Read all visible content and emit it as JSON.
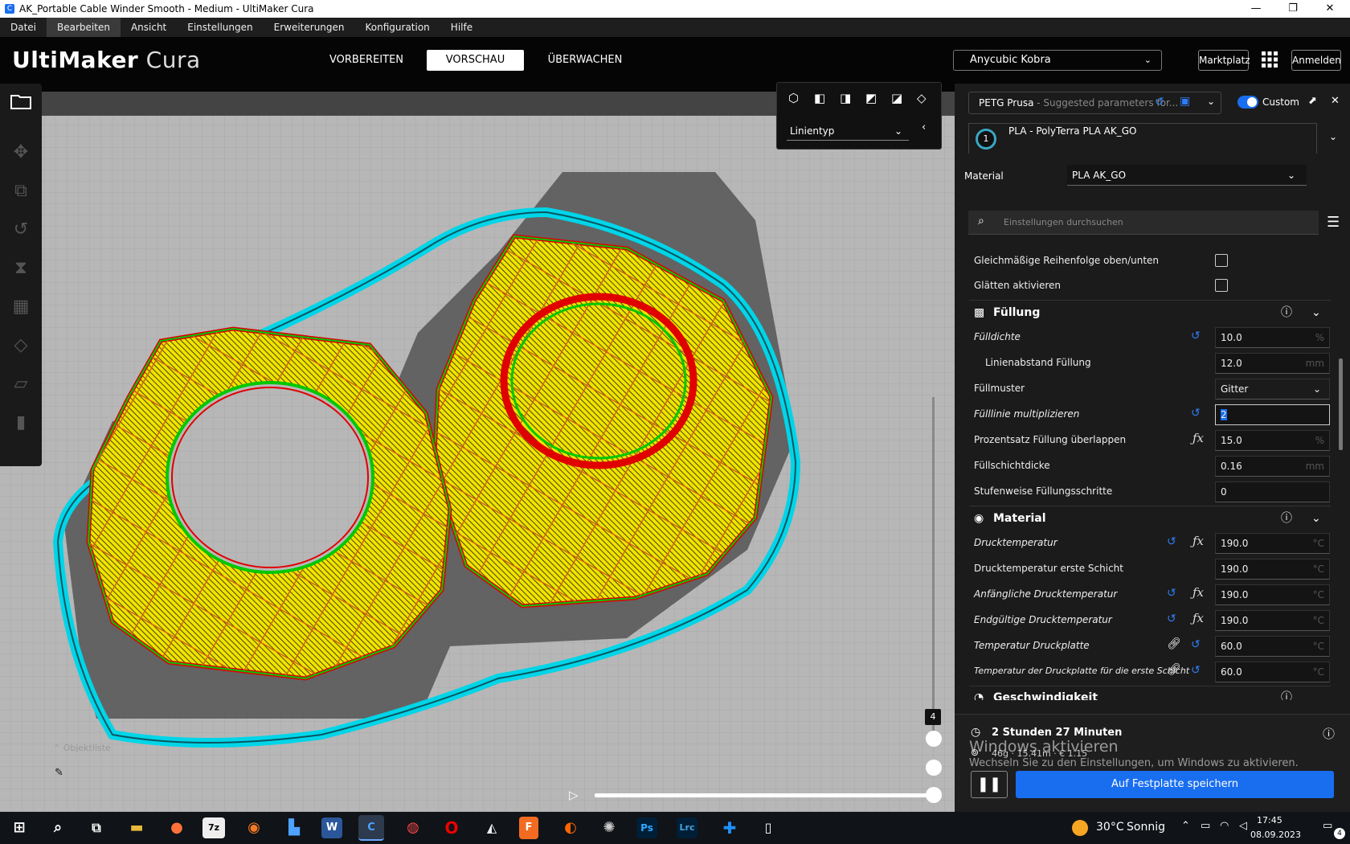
{
  "window": {
    "title": "AK_Portable Cable Winder Smooth - Medium - UltiMaker Cura"
  },
  "menu": [
    "Datei",
    "Bearbeiten",
    "Ansicht",
    "Einstellungen",
    "Erweiterungen",
    "Konfiguration",
    "Hilfe"
  ],
  "header": {
    "logo_bold": "UltiMaker",
    "logo_light": "Cura",
    "stages": [
      "VORBEREITEN",
      "VORSCHAU",
      "ÜBERWACHEN"
    ],
    "printer": "Anycubic Kobra",
    "marketplace": "Marktplatz",
    "signin": "Anmelden"
  },
  "viewport": {
    "view_type": "Linientyp",
    "layer_number": "4",
    "object_list": "Objektliste"
  },
  "profile": {
    "name": "PETG Prusa",
    "suffix": " - Suggested parameters for...",
    "custom_label": "Custom"
  },
  "extruder": {
    "number": "1",
    "material": "PLA - PolyTerra PLA AK_GO"
  },
  "material_row": {
    "label": "Material",
    "value": "PLA AK_GO"
  },
  "search": {
    "placeholder": "Einstellungen durchsuchen"
  },
  "settings_top": [
    {
      "label": "Gleichmäßige Reihenfolge oben/unten"
    },
    {
      "label": "Glätten aktivieren"
    }
  ],
  "sections": {
    "infill": "Füllung",
    "material": "Material",
    "speed": "Geschwindigkeit"
  },
  "infill": [
    {
      "label": "Fülldichte",
      "value": "10.0",
      "unit": "%"
    },
    {
      "label": "Linienabstand Füllung",
      "value": "12.0",
      "unit": "mm"
    },
    {
      "label": "Füllmuster",
      "value": "Gitter"
    },
    {
      "label": "Fülllinie multiplizieren",
      "value": "2"
    },
    {
      "label": "Prozentsatz Füllung überlappen",
      "value": "15.0",
      "unit": "%"
    },
    {
      "label": "Füllschichtdicke",
      "value": "0.16",
      "unit": "mm"
    },
    {
      "label": "Stufenweise Füllungsschritte",
      "value": "0"
    }
  ],
  "material": [
    {
      "label": "Drucktemperatur",
      "value": "190.0",
      "unit": "°C"
    },
    {
      "label": "Drucktemperatur erste Schicht",
      "value": "190.0",
      "unit": "°C"
    },
    {
      "label": "Anfängliche Drucktemperatur",
      "value": "190.0",
      "unit": "°C"
    },
    {
      "label": "Endgültige Drucktemperatur",
      "value": "190.0",
      "unit": "°C"
    },
    {
      "label": "Temperatur Druckplatte",
      "value": "60.0",
      "unit": "°C"
    },
    {
      "label": "Temperatur der Druckplatte für die erste Schicht",
      "value": "60.0",
      "unit": "°C"
    }
  ],
  "estimate": {
    "time": "2 Stunden 27 Minuten",
    "material": "46g · 15.41m · € 1.15",
    "save": "Auf Festplatte speichern"
  },
  "watermark": {
    "line1": "Windows aktivieren",
    "line2": "Wechseln Sie zu den Einstellungen, um Windows zu aktivieren."
  },
  "taskbar": {
    "weather_temp": "30°C",
    "weather_text": "Sonnig",
    "time": "17:45",
    "date": "08.09.2023",
    "notif": "4"
  },
  "colors": {
    "accent": "#196ef0",
    "infill": "#f2e600",
    "wall_outer": "#e00000",
    "wall_inner": "#00c800",
    "skirt": "#00d5e8"
  }
}
